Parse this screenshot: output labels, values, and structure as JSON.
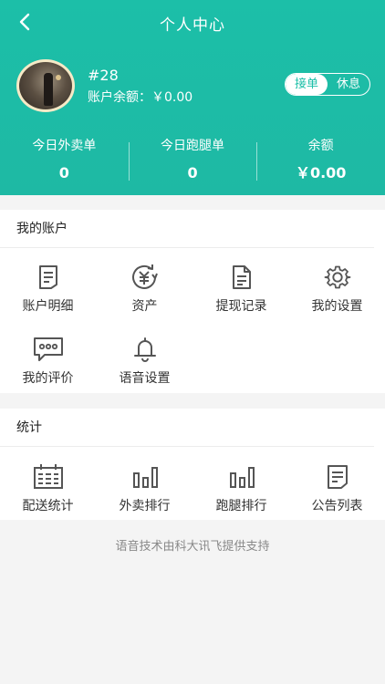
{
  "nav": {
    "title": "个人中心"
  },
  "user": {
    "id": "#28",
    "balance_line": "账户余额：￥0.00"
  },
  "status_toggle": {
    "options": [
      "接单",
      "休息"
    ],
    "active_index": 0
  },
  "stats": [
    {
      "label": "今日外卖单",
      "value": "0"
    },
    {
      "label": "今日跑腿单",
      "value": "0"
    },
    {
      "label": "余额",
      "value": "￥0.00"
    }
  ],
  "account_section": {
    "title": "我的账户",
    "items": [
      {
        "label": "账户明细",
        "icon": "document-lines-icon"
      },
      {
        "label": "资产",
        "icon": "yen-refresh-icon"
      },
      {
        "label": "提现记录",
        "icon": "record-document-icon"
      },
      {
        "label": "我的设置",
        "icon": "gear-icon"
      },
      {
        "label": "我的评价",
        "icon": "chat-bubble-icon"
      },
      {
        "label": "语音设置",
        "icon": "bell-icon"
      }
    ]
  },
  "stats_section": {
    "title": "统计",
    "items": [
      {
        "label": "配送统计",
        "icon": "calendar-icon"
      },
      {
        "label": "外卖排行",
        "icon": "bar-chart-icon"
      },
      {
        "label": "跑腿排行",
        "icon": "bar-chart-icon"
      },
      {
        "label": "公告列表",
        "icon": "notice-list-icon"
      }
    ]
  },
  "footer": {
    "text": "语音技术由科大讯飞提供支持"
  },
  "colors": {
    "primary": "#1cbfa8",
    "icon": "#555555"
  }
}
